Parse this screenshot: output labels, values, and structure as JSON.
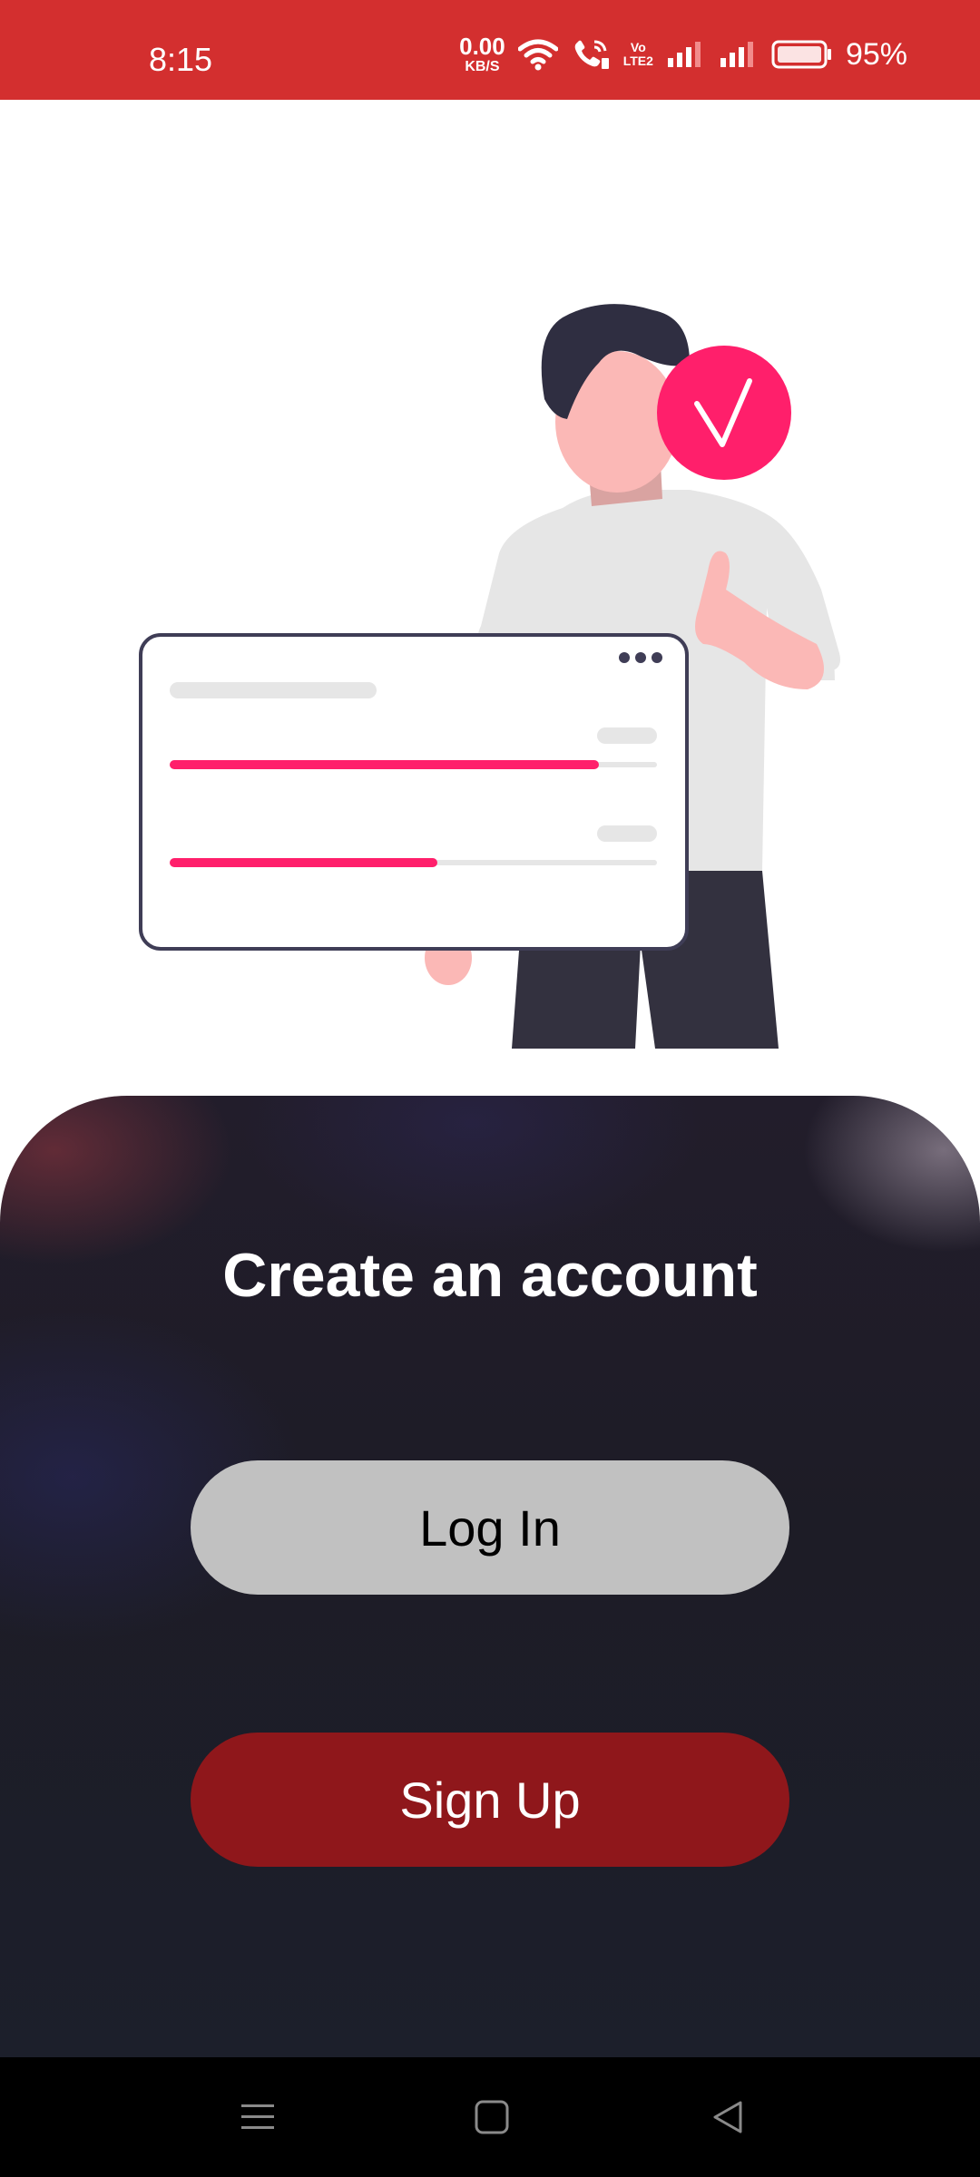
{
  "status_bar": {
    "time": "8:15",
    "net_speed_value": "0.00",
    "net_speed_unit": "KB/S",
    "volte_top": "Vo",
    "volte_bottom": "LTE2",
    "battery_percent": "95%",
    "battery_level": 0.95,
    "background_color": "#d32f2f",
    "icons": [
      "wifi-icon",
      "wifi-calling-icon",
      "volte-icon",
      "signal-sim1-icon",
      "signal-sim2-icon",
      "battery-icon"
    ]
  },
  "illustration": {
    "description_icon": "person-with-checkmark-illustration",
    "accent_color": "#ff1f6b",
    "progress_bars": [
      0.88,
      0.55
    ]
  },
  "panel": {
    "title": "Create an account",
    "login_label": "Log In",
    "signup_label": "Sign Up",
    "login_color": "#c1c1c1",
    "signup_color": "#8f171b"
  },
  "nav_bar": {
    "icons": [
      "menu-icon",
      "home-square-icon",
      "back-triangle-icon"
    ]
  }
}
